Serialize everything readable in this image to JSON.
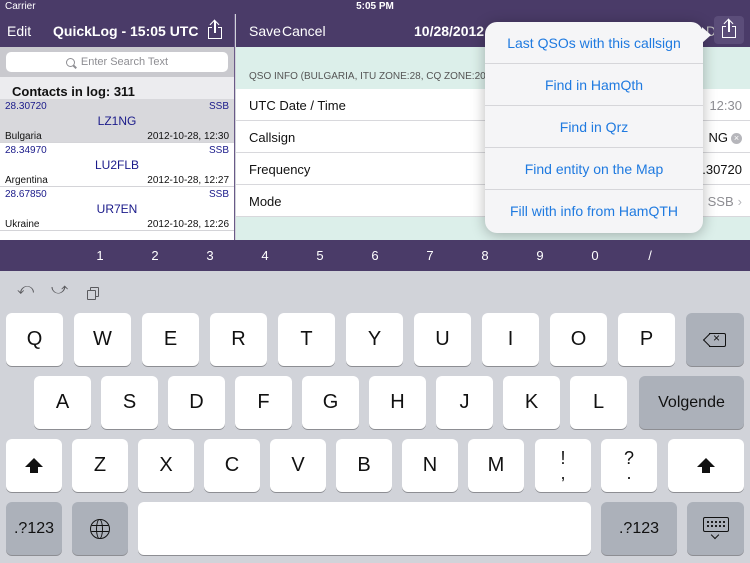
{
  "status": {
    "carrier": "Carrier",
    "time": "5:05 PM"
  },
  "left": {
    "edit": "Edit",
    "title": "QuickLog - 15:05 UTC",
    "search_placeholder": "Enter Search Text",
    "contacts_count": "Contacts in log: 311",
    "contacts": [
      {
        "freq": "28.30720",
        "mode": "SSB",
        "call": "LZ1NG",
        "country": "Bulgaria",
        "datetime": "2012-10-28, 12:30"
      },
      {
        "freq": "28.34970",
        "mode": "SSB",
        "call": "LU2FLB",
        "country": "Argentina",
        "datetime": "2012-10-28, 12:27"
      },
      {
        "freq": "28.67850",
        "mode": "SSB",
        "call": "UR7EN",
        "country": "Ukraine",
        "datetime": "2012-10-28, 12:26"
      }
    ]
  },
  "right": {
    "save": "Save",
    "cancel": "Cancel",
    "title": "10/28/2012,",
    "dim_text": "D",
    "section": "QSO INFO (BULGARIA, ITU ZONE:28, CQ ZONE:20, D",
    "rows": [
      {
        "label": "UTC Date / Time",
        "value": "12:30"
      },
      {
        "label": "Callsign",
        "value": "NG"
      },
      {
        "label": "Frequency",
        "value": ".30720"
      },
      {
        "label": "Mode",
        "value": "SSB"
      }
    ]
  },
  "popover": {
    "items": [
      "Last QSOs with this callsign",
      "Find in HamQth",
      "Find in Qrz",
      "Find entity on the Map",
      "Fill with info from HamQTH"
    ]
  },
  "numbar": [
    "1",
    "2",
    "3",
    "4",
    "5",
    "6",
    "7",
    "8",
    "9",
    "0",
    "/"
  ],
  "keyboard": {
    "undo": "⤺",
    "redo": "⤻",
    "row1": [
      "Q",
      "W",
      "E",
      "R",
      "T",
      "Y",
      "U",
      "I",
      "O",
      "P"
    ],
    "row2": [
      "A",
      "S",
      "D",
      "F",
      "G",
      "H",
      "J",
      "K",
      "L"
    ],
    "row3": [
      "Z",
      "X",
      "C",
      "V",
      "B",
      "N",
      "M"
    ],
    "return_label": "Volgende",
    "excl_top": "!",
    "excl_bottom": ",",
    "quest_top": "?",
    "quest_bottom": ".",
    "numbers_label": ".?123"
  },
  "colors": {
    "nav": "#4a3b68",
    "accent": "#1f7ae0",
    "list_text": "#1a1a8a"
  }
}
